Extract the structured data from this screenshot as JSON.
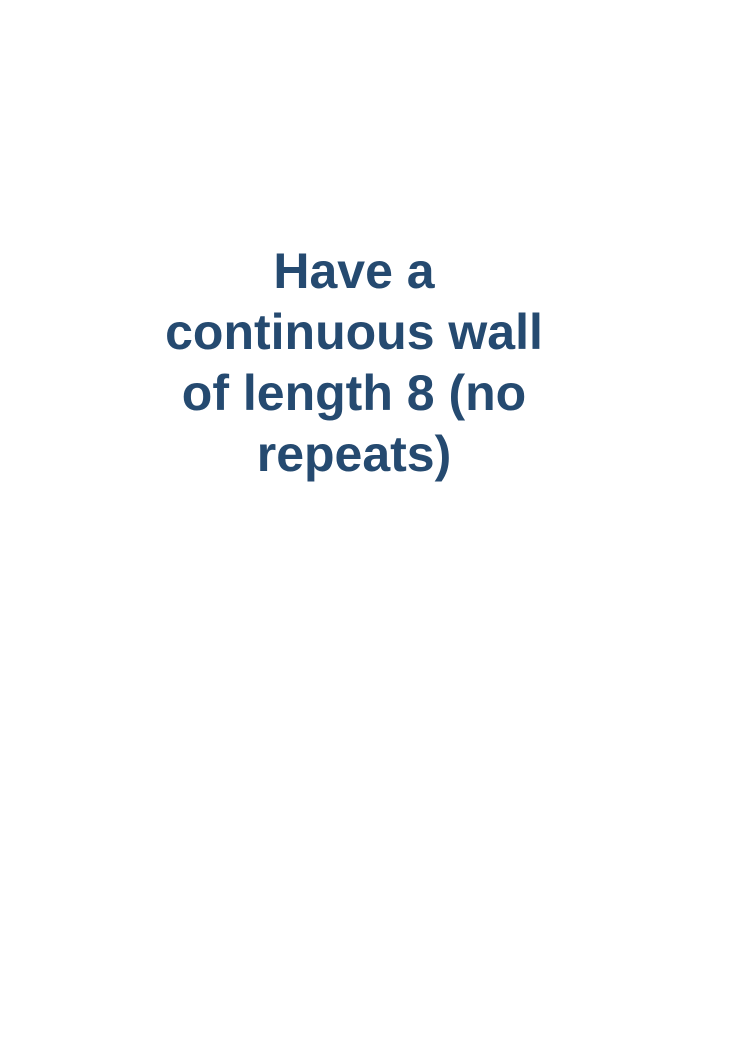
{
  "card": {
    "lines": [
      "Have a",
      "continuous wall",
      "of length 8 (no",
      "repeats)"
    ]
  },
  "colors": {
    "text": "#254a70",
    "background": "#ffffff"
  }
}
